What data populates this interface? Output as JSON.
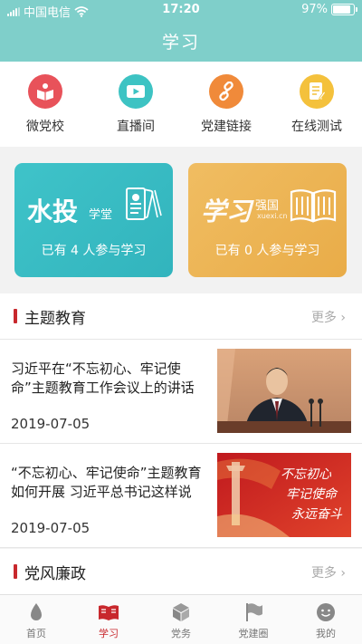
{
  "status_bar": {
    "carrier": "中国电信",
    "time": "17:20",
    "battery": "97%",
    "battery_level": 0.97
  },
  "header": {
    "title": "学习"
  },
  "quick_menu": [
    {
      "label": "微党校",
      "icon": "book-icon",
      "color": "#e8525a"
    },
    {
      "label": "直播间",
      "icon": "video-icon",
      "color": "#3dc3c3"
    },
    {
      "label": "党建链接",
      "icon": "link-icon",
      "color": "#f08a3a"
    },
    {
      "label": "在线测试",
      "icon": "test-icon",
      "color": "#f4c13c"
    }
  ],
  "cards": [
    {
      "logo_big": "水投",
      "logo_small": "学堂",
      "count_text": "已有 4 人参与学习",
      "color": "#3fbfc6"
    },
    {
      "logo_big": "学习",
      "logo_small": "强国",
      "logo_url": "xuexi.cn",
      "count_text": "已有 0 人参与学习",
      "color": "#efb555"
    }
  ],
  "section1": {
    "title": "主题教育",
    "more": "更多"
  },
  "news": [
    {
      "title": "习近平在“不忘初心、牢记使命”主题教育工作会议上的讲话",
      "date": "2019-07-05"
    },
    {
      "title": "“不忘初心、牢记使命”主题教育如何开展 习近平总书记这样说",
      "date": "2019-07-05",
      "thumb_text": [
        "不忘初心",
        "牢记使命",
        "永远奋斗"
      ]
    }
  ],
  "section2": {
    "title": "党风廉政",
    "more": "更多"
  },
  "tabs": [
    {
      "label": "首页",
      "icon": "home-icon"
    },
    {
      "label": "学习",
      "icon": "study-icon",
      "active": true
    },
    {
      "label": "党务",
      "icon": "party-affairs-icon"
    },
    {
      "label": "党建圈",
      "icon": "flag-icon"
    },
    {
      "label": "我的",
      "icon": "profile-icon"
    }
  ],
  "colors": {
    "header": "#7fcfca",
    "accent": "#c8282d"
  }
}
